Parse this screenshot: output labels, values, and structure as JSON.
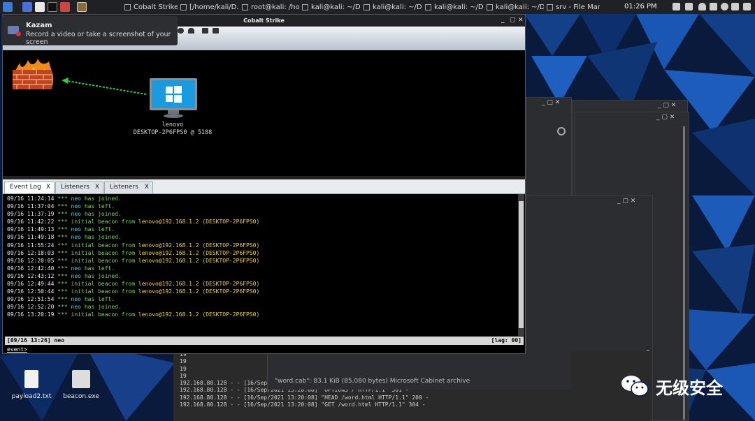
{
  "taskbar": {
    "tasks": [
      "Cobalt Strike",
      "[/home/kali/D...",
      "root@kali: /ho...",
      "kali@kali: ~/D...",
      "kali@kali: ~/D...",
      "kali@kali: ~/D...",
      "kali@kali: ~/D...",
      "srv - File Man..."
    ],
    "clock": "01:26 PM"
  },
  "notification": {
    "title": "Kazam",
    "body": "Record a video or take a screenshot of your screen"
  },
  "cobalt": {
    "title": "Cobalt Strike",
    "host": {
      "name": "lenovo",
      "id": "DESKTOP-2P6FPS0 @ 5188"
    },
    "tabs": [
      {
        "label": "Event Log",
        "close": "X"
      },
      {
        "label": "Listeners",
        "close": "X"
      },
      {
        "label": "Listeners",
        "close": "X"
      }
    ],
    "log": [
      {
        "ts": "09/16 11:24:14",
        "stars": "***",
        "type": "join",
        "name": "neo",
        "text": "has joined."
      },
      {
        "ts": "09/16 11:37:04",
        "stars": "***",
        "type": "join",
        "name": "neo",
        "text": "has left."
      },
      {
        "ts": "09/16 11:37:19",
        "stars": "***",
        "type": "join",
        "name": "neo",
        "text": "has joined."
      },
      {
        "ts": "09/16 11:42:22",
        "stars": "***",
        "type": "beacon",
        "name": "initial beacon from",
        "text": "lenovo@192.168.1.2 (DESKTOP-2P6FPS0)"
      },
      {
        "ts": "09/16 11:49:13",
        "stars": "***",
        "type": "join",
        "name": "neo",
        "text": "has left."
      },
      {
        "ts": "09/16 11:49:18",
        "stars": "***",
        "type": "join",
        "name": "neo",
        "text": "has joined."
      },
      {
        "ts": "09/16 11:55:24",
        "stars": "***",
        "type": "beacon",
        "name": "initial beacon from",
        "text": "lenovo@192.168.1.2 (DESKTOP-2P6FPS0)"
      },
      {
        "ts": "09/16 12:18:03",
        "stars": "***",
        "type": "beacon",
        "name": "initial beacon from",
        "text": "lenovo@192.168.1.2 (DESKTOP-2P6FPS0)"
      },
      {
        "ts": "09/16 12:20:05",
        "stars": "***",
        "type": "beacon",
        "name": "initial beacon from",
        "text": "lenovo@192.168.1.2 (DESKTOP-2P6FPS0)"
      },
      {
        "ts": "09/16 12:42:40",
        "stars": "***",
        "type": "join",
        "name": "neo",
        "text": "has left."
      },
      {
        "ts": "09/16 12:43:12",
        "stars": "***",
        "type": "join",
        "name": "neo",
        "text": "has joined."
      },
      {
        "ts": "09/16 12:49:44",
        "stars": "***",
        "type": "beacon",
        "name": "initial beacon from",
        "text": "lenovo@192.168.1.2 (DESKTOP-2P6FPS0)"
      },
      {
        "ts": "09/16 12:50:44",
        "stars": "***",
        "type": "beacon",
        "name": "initial beacon from",
        "text": "lenovo@192.168.1.2 (DESKTOP-2P6FPS0)"
      },
      {
        "ts": "09/16 12:51:54",
        "stars": "***",
        "type": "join",
        "name": "neo",
        "text": "has left."
      },
      {
        "ts": "09/16 12:52:20",
        "stars": "***",
        "type": "join",
        "name": "neo",
        "text": "has joined."
      },
      {
        "ts": "09/16 13:20:19",
        "stars": "***",
        "type": "beacon",
        "name": "initial beacon from",
        "text": "lenovo@192.168.1.2 (DESKTOP-2P6FPS0)"
      }
    ],
    "status_left": "[09/16 13:26] neo",
    "status_right": "[lag: 00]",
    "prompt": "event>"
  },
  "filemanager": {
    "status": "\"word.cab\": 83.1 KiB (85,080 bytes) Microsoft Cabinet archive"
  },
  "terminal": {
    "lines": [
      "19",
      "19",
      "19",
      "19",
      "192.168.80.128 - - [16/Sep/2021 13:20:08] code 501, message Unsupported method ('OPTIONS')",
      "192.168.80.128 - - [16/Sep/2021 13:20:08] \"OPTIONS / HTTP/1.1\" 501 -",
      "192.168.80.128 - - [16/Sep/2021 13:20:08] \"HEAD /word.html HTTP/1.1\" 200 -",
      "192.168.80.128 - - [16/Sep/2021 13:20:08] \"GET /word.html HTTP/1.1\" 304 -"
    ]
  },
  "desktop": {
    "icons": [
      {
        "label": "payload2.txt"
      },
      {
        "label": "beacon.exe"
      }
    ]
  },
  "watermark": "无级安全",
  "colors": {
    "timestamp": "#e8e8e8",
    "stars": "#7fd45a",
    "user": "#4fd0e0",
    "beacon": "#f2d23c"
  }
}
